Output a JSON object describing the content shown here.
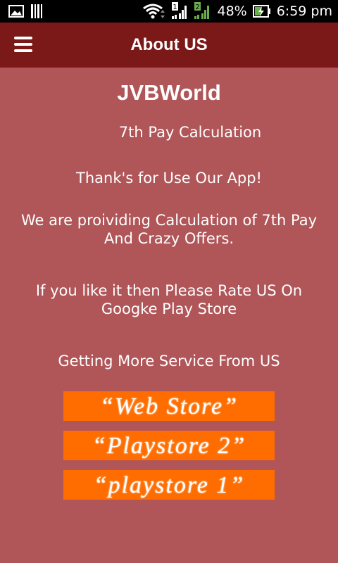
{
  "status_bar": {
    "battery": "48%",
    "time": "6:59 pm",
    "icons": [
      "image-icon",
      "barcode-icon",
      "wifi-icon",
      "signal-1-icon",
      "signal-2-icon",
      "battery-charging-icon"
    ]
  },
  "app_bar": {
    "title": "About US",
    "menu_icon": "hamburger-menu-icon"
  },
  "main": {
    "brand": "JVBWorld",
    "subtitle": "7th Pay Calculation",
    "thanks": "Thank's for Use Our App!",
    "providing_line1": "We are proividing Calculation of 7th Pay",
    "providing_line2": "And Crazy Offers.",
    "rate_line1": "If you like it then Please Rate US On",
    "rate_line2": "Googke Play Store",
    "more_service": "Getting More Service From US"
  },
  "buttons": [
    {
      "label": "“Web Store”"
    },
    {
      "label": "“Playstore 2”"
    },
    {
      "label": "“playstore 1”"
    }
  ],
  "colors": {
    "background": "#b05558",
    "app_bar": "#7b1818",
    "button": "#ff6d00",
    "status_bar": "#000000"
  }
}
